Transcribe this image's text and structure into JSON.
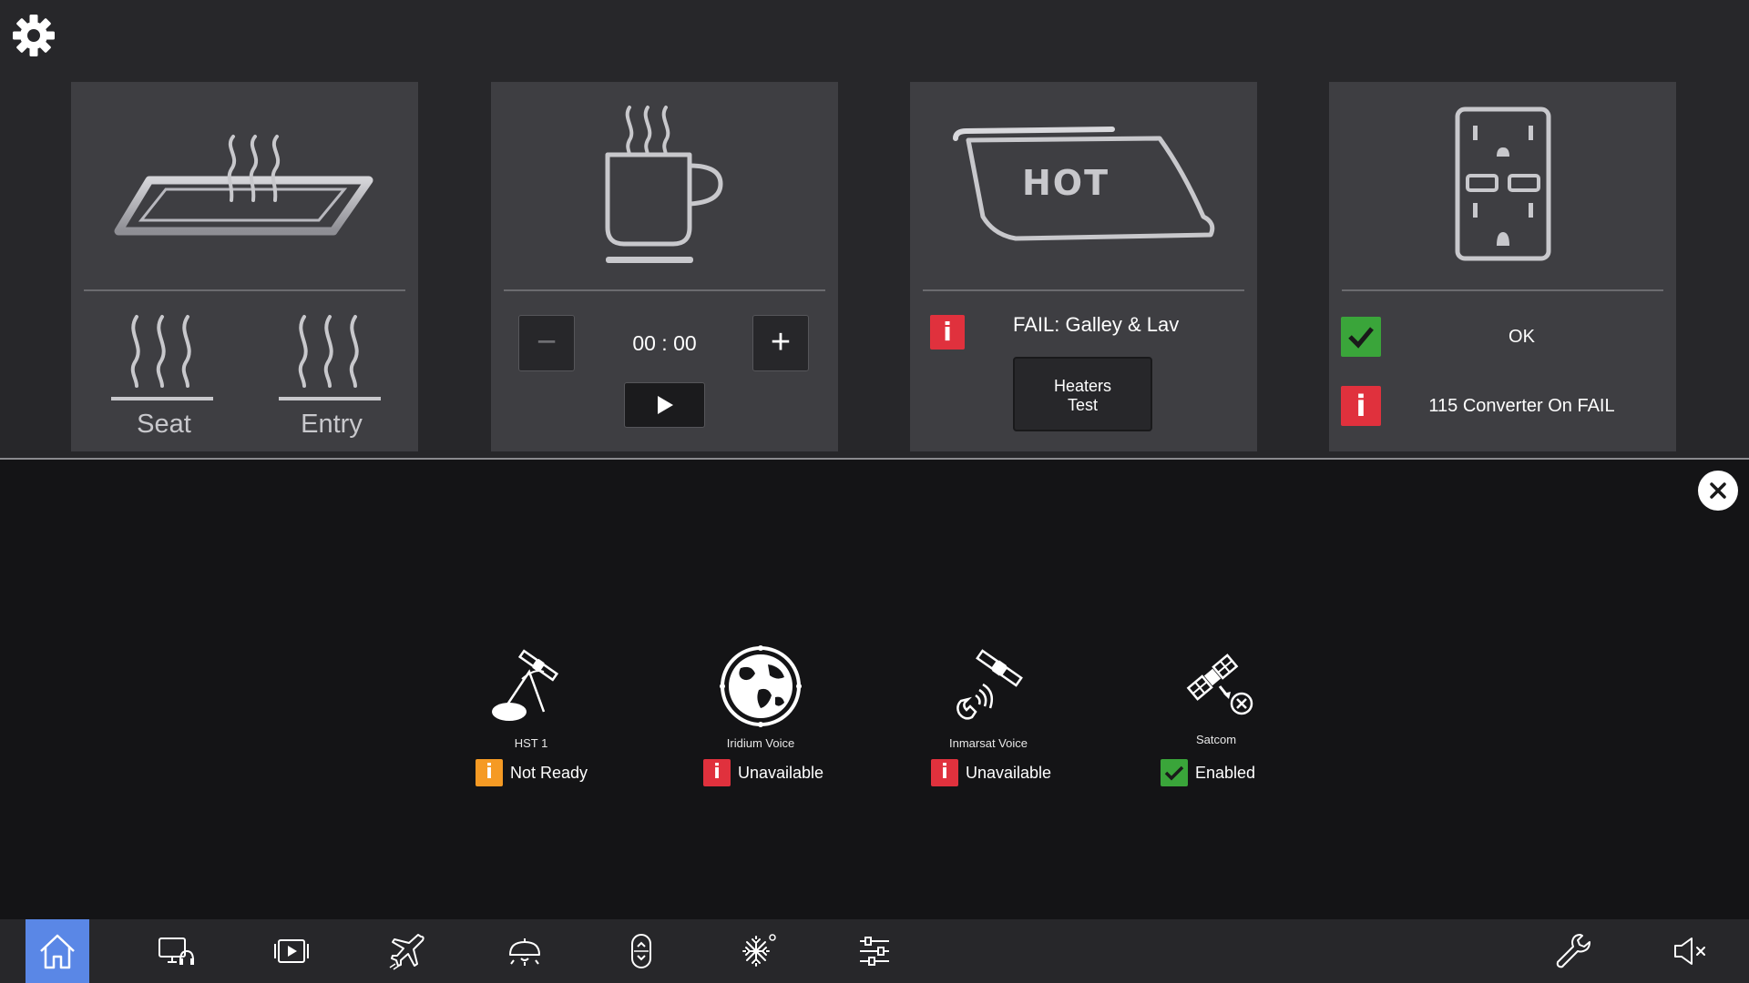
{
  "colors": {
    "status_error": "#e0313d",
    "status_ok": "#3aa53a",
    "status_warning": "#f59a24",
    "nav_active": "#5a87e6",
    "card_bg": "#3e3e42"
  },
  "cards": {
    "seat_heating": {
      "icon": "heated-tray-icon",
      "seat_label": "Seat",
      "entry_label": "Entry"
    },
    "beverage_timer": {
      "icon": "hot-cup-icon",
      "timer_value": "00 : 00",
      "decrement_icon": "minus-icon",
      "increment_icon": "plus-icon",
      "play_icon": "play-icon"
    },
    "heaters": {
      "icon_text": "HOT",
      "status_icon": "info-icon",
      "status_text": "FAIL: Galley & Lav",
      "test_button_line1": "Heaters",
      "test_button_line2": "Test"
    },
    "power_outlet": {
      "icon": "power-outlet-icon",
      "outlet_status_icon": "check-icon",
      "outlet_status_text": "OK",
      "converter_status_icon": "info-icon",
      "converter_status_text": "115 Converter On FAIL"
    }
  },
  "communications": [
    {
      "icon": "satellite-dish-icon",
      "name": "HST 1",
      "status_icon": "info-icon",
      "status_level": "warning",
      "status_text": "Not Ready"
    },
    {
      "icon": "globe-icon",
      "name": "Iridium Voice",
      "status_icon": "info-icon",
      "status_level": "error",
      "status_text": "Unavailable"
    },
    {
      "icon": "satellite-phone-icon",
      "name": "Inmarsat Voice",
      "status_icon": "info-icon",
      "status_level": "error",
      "status_text": "Unavailable"
    },
    {
      "icon": "satellite-disabled-icon",
      "name": "Satcom",
      "status_icon": "check-icon",
      "status_level": "ok",
      "status_text": "Enabled"
    }
  ],
  "glyphs": {
    "minus": "−",
    "plus": "+",
    "info": "i",
    "check": "✓"
  },
  "nav": {
    "items": [
      "home-icon",
      "monitor-headset-icon",
      "media-player-icon",
      "airplane-icon",
      "cabin-light-icon",
      "window-shade-icon",
      "climate-snowflake-icon",
      "sliders-icon"
    ],
    "active": "home-icon",
    "right_items": [
      "wrench-icon",
      "mute-icon"
    ]
  }
}
